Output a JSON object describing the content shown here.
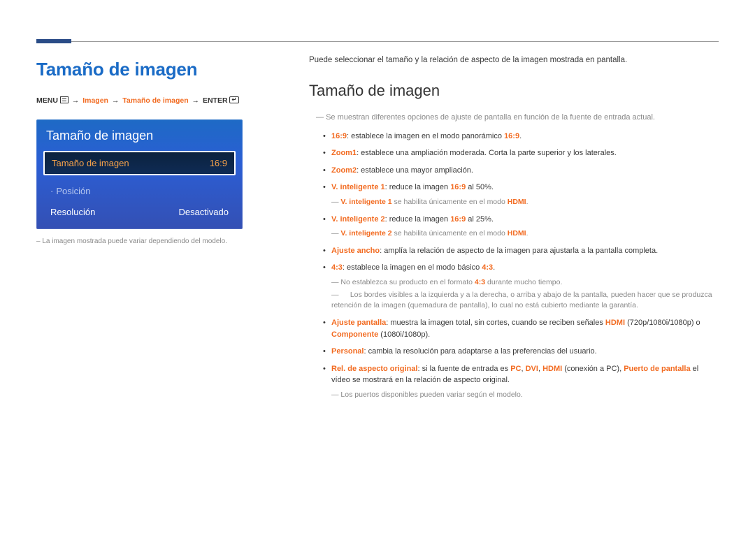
{
  "header": {},
  "left": {
    "h1": "Tamaño de imagen",
    "breadcrumb": {
      "menu": "MENU",
      "imagen": "Imagen",
      "tamano": "Tamaño de imagen",
      "enter": "ENTER"
    },
    "osd": {
      "title": "Tamaño de imagen",
      "selected_label": "Tamaño de imagen",
      "selected_value": "16:9",
      "row_posicion": "Posición",
      "row_resolucion": "Resolución",
      "row_resolucion_value": "Desactivado"
    },
    "footnote": "La imagen mostrada puede variar dependiendo del modelo."
  },
  "right": {
    "intro": "Puede seleccionar el tamaño y la relación de aspecto de la imagen mostrada en pantalla.",
    "h2": "Tamaño de imagen",
    "dash1": "Se muestran diferentes opciones de ajuste de pantalla en función de la fuente de entrada actual.",
    "items": {
      "i169_lbl": "16:9",
      "i169_txt": ": establece la imagen en el modo panorámico ",
      "i169_suf": "16:9",
      "i169_dot": ".",
      "zoom1_lbl": "Zoom1",
      "zoom1_txt": ": establece una ampliación moderada. Corta la parte superior y los laterales.",
      "zoom2_lbl": "Zoom2",
      "zoom2_txt": ": establece una mayor ampliación.",
      "vi1_lbl": "V. inteligente 1",
      "vi1_txt": ": reduce la imagen ",
      "vi1_mid": "16:9",
      "vi1_end": " al 50%.",
      "vi1_note_a": "V. inteligente 1",
      "vi1_note_b": " se habilita únicamente en el modo ",
      "vi1_note_c": "HDMI",
      "vi1_note_d": ".",
      "vi2_lbl": "V. inteligente 2",
      "vi2_txt": ": reduce la imagen ",
      "vi2_mid": "16:9",
      "vi2_end": " al 25%.",
      "vi2_note_a": "V. inteligente 2",
      "vi2_note_b": "  se habilita únicamente en el modo ",
      "vi2_note_c": "HDMI",
      "vi2_note_d": ".",
      "aa_lbl": "Ajuste ancho",
      "aa_txt": ": amplía la relación de aspecto de la imagen para ajustarla a la pantalla completa.",
      "i43_lbl": "4:3",
      "i43_txt": ": establece la imagen en el modo básico ",
      "i43_suf": "4:3",
      "i43_dot": ".",
      "i43_note1": "No establezca su producto en el formato ",
      "i43_note1_b": "4:3",
      "i43_note1_c": " durante mucho tiempo.",
      "i43_note2": "Los bordes visibles a la izquierda y a la derecha, o arriba y abajo de la pantalla, pueden hacer que se produzca retención de la imagen (quemadura de pantalla), lo cual no está cubierto mediante la garantía.",
      "ap_lbl": "Ajuste pantalla",
      "ap_txt": ": muestra la imagen total, sin cortes, cuando se reciben señales ",
      "ap_hdmi": "HDMI",
      "ap_mid": " (720p/1080i/1080p) o ",
      "ap_comp": "Componente",
      "ap_end": " (1080i/1080p).",
      "pers_lbl": "Personal",
      "pers_txt": ": cambia la resolución para adaptarse a las preferencias del usuario.",
      "rel_lbl": "Rel. de aspecto original",
      "rel_txt1": ": si la fuente de entrada es ",
      "rel_pc": "PC",
      "rel_sep1": ", ",
      "rel_dvi": "DVI",
      "rel_sep2": ", ",
      "rel_hdmi": "HDMI",
      "rel_mid": " (conexión a PC), ",
      "rel_pp": "Puerto de pantalla",
      "rel_end": " el vídeo se mostrará en la relación de aspecto original.",
      "rel_note": "Los puertos disponibles pueden variar según el modelo."
    }
  }
}
